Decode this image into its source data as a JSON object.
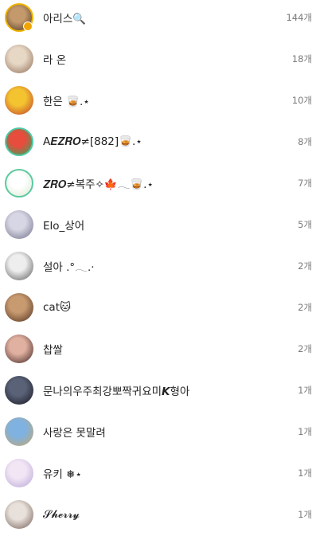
{
  "friends": [
    {
      "name": "아리스🔍",
      "count": "144개",
      "avatar": {
        "colors": [
          "#c49a6c",
          "#4a3526"
        ],
        "ring": "#f0b400",
        "badge": true
      }
    },
    {
      "name": "라 온",
      "count": "18개",
      "avatar": {
        "colors": [
          "#e7d7c5",
          "#8c6b54"
        ],
        "ring": "",
        "badge": false
      }
    },
    {
      "name": "한은 🥃.⋆",
      "count": "10개",
      "avatar": {
        "colors": [
          "#f4c430",
          "#c0392b"
        ],
        "ring": "",
        "badge": false
      }
    },
    {
      "name": "A𝑬𝒁𝑹𝑶≠[882]🥃.⋆",
      "count": "8개",
      "avatar": {
        "colors": [
          "#e74c3c",
          "#27ae60"
        ],
        "ring": "#4cc9a6",
        "badge": false
      }
    },
    {
      "name": "𝒁𝑹𝑶≠복주✧🍁𓂃🥃.⋆",
      "count": "7개",
      "avatar": {
        "colors": [
          "#ffffff",
          "#d8e8d0"
        ],
        "ring": "#5cc9a0",
        "badge": false
      }
    },
    {
      "name": "Elo_상어",
      "count": "5개",
      "avatar": {
        "colors": [
          "#d6d6e4",
          "#6e6e88"
        ],
        "ring": "",
        "badge": false
      }
    },
    {
      "name": "설아 .°𓂃.·",
      "count": "2개",
      "avatar": {
        "colors": [
          "#eeeeee",
          "#555555"
        ],
        "ring": "",
        "badge": false
      }
    },
    {
      "name": "cat🐱",
      "count": "2개",
      "avatar": {
        "colors": [
          "#c89a70",
          "#4a2e1c"
        ],
        "ring": "",
        "badge": false
      }
    },
    {
      "name": "찹쌀",
      "count": "2개",
      "avatar": {
        "colors": [
          "#e0b0a0",
          "#3a1f1f"
        ],
        "ring": "",
        "badge": false
      }
    },
    {
      "name": "문나의우주최강뽀짝귀요미𝙆형아",
      "count": "1개",
      "avatar": {
        "colors": [
          "#5a6278",
          "#15151f"
        ],
        "ring": "",
        "badge": false
      }
    },
    {
      "name": "사랑은 못말려",
      "count": "1개",
      "avatar": {
        "colors": [
          "#7fb2e0",
          "#c9a66b"
        ],
        "ring": "",
        "badge": false
      }
    },
    {
      "name": "유키 ❅⋆",
      "count": "1개",
      "avatar": {
        "colors": [
          "#f2e6f5",
          "#b7a4d6"
        ],
        "ring": "",
        "badge": false
      }
    },
    {
      "name": "𝓢𝓱𝓮𝓻𝓻𝔂",
      "count": "1개",
      "avatar": {
        "colors": [
          "#e8e0da",
          "#6e5a52"
        ],
        "ring": "",
        "badge": false
      }
    }
  ]
}
